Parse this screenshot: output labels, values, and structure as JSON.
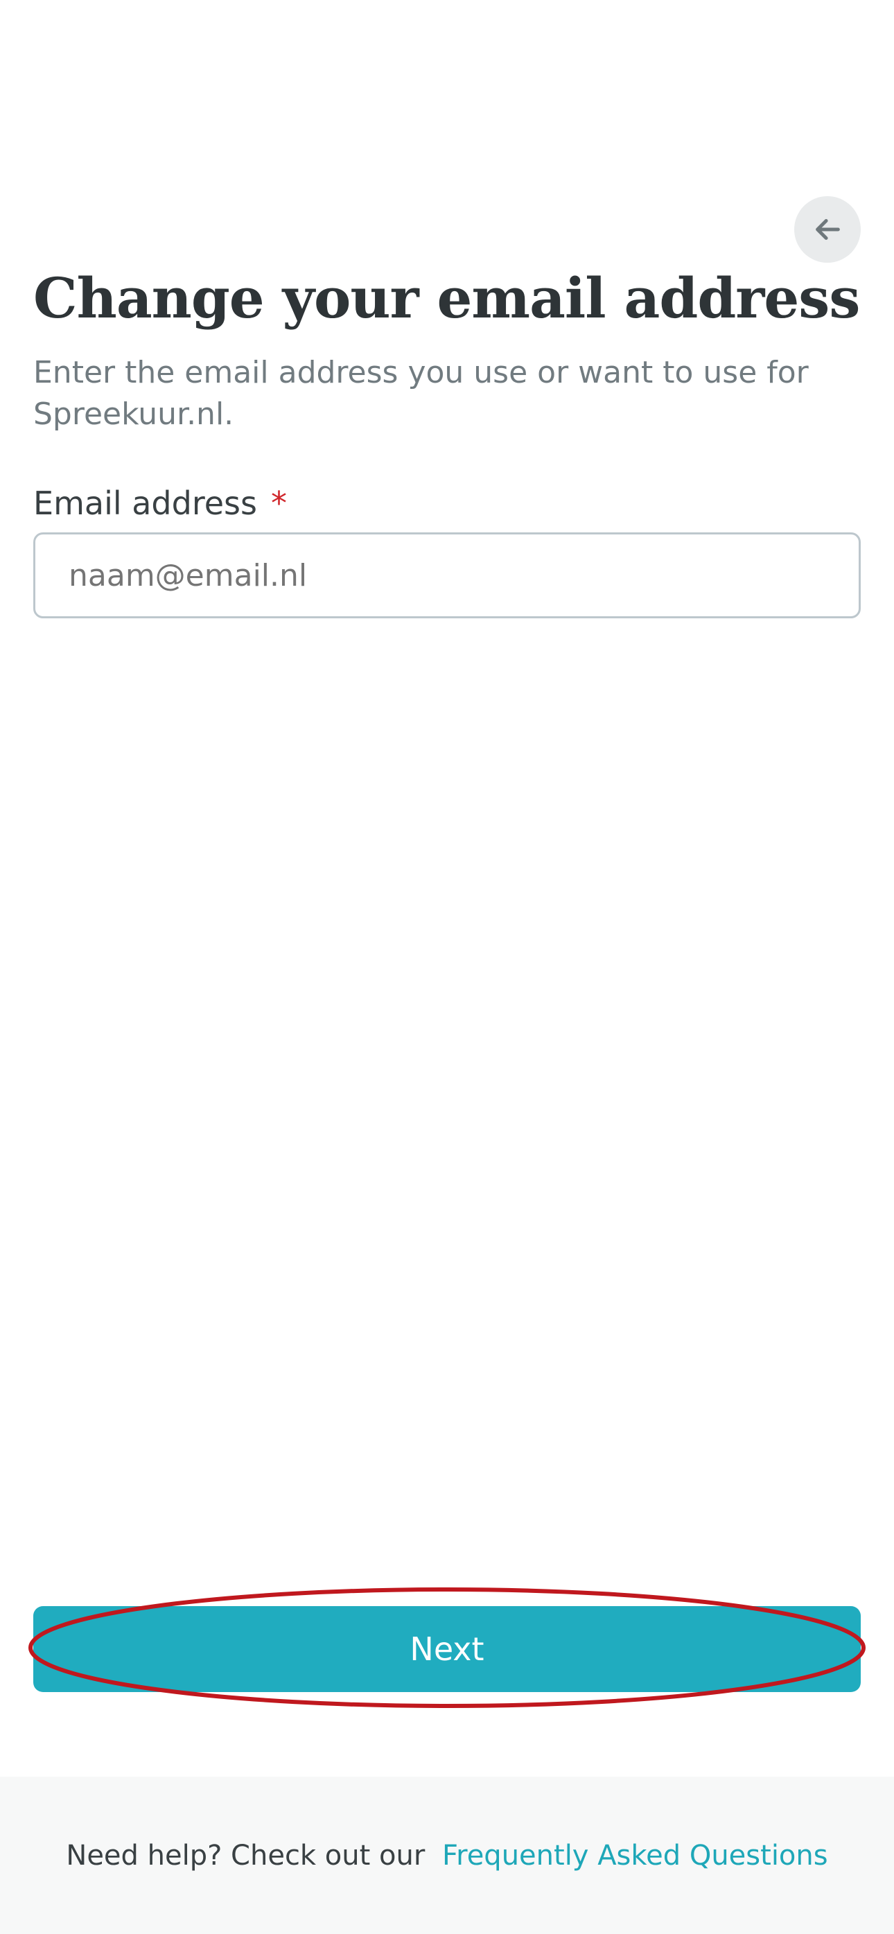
{
  "header": {
    "back_icon": "arrow-left-icon"
  },
  "page": {
    "title": "Change your email address",
    "subtitle": "Enter the email address you use or want to use for Spreekuur.nl."
  },
  "form": {
    "email_label": "Email address",
    "required_marker": "*",
    "email_placeholder": "naam@email.nl",
    "email_value": ""
  },
  "actions": {
    "next_label": "Next"
  },
  "footer": {
    "help_text": "Need help? Check out our",
    "faq_link": "Frequently Asked Questions"
  },
  "colors": {
    "primary": "#20acbf",
    "link": "#1ea7b8",
    "required": "#d0262b",
    "highlight": "#c0181e"
  }
}
